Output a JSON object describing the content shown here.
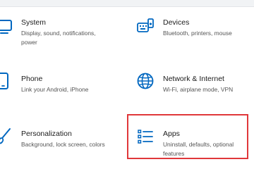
{
  "settings": {
    "tiles": [
      {
        "title": "System",
        "desc": "Display, sound, notifications, power",
        "icon": "monitor-icon"
      },
      {
        "title": "Devices",
        "desc": "Bluetooth, printers, mouse",
        "icon": "keyboard-speaker-icon"
      },
      {
        "title": "Phone",
        "desc": "Link your Android, iPhone",
        "icon": "phone-icon"
      },
      {
        "title": "Network & Internet",
        "desc": "Wi-Fi, airplane mode, VPN",
        "icon": "globe-icon"
      },
      {
        "title": "Personalization",
        "desc": "Background, lock screen, colors",
        "icon": "paintbrush-icon"
      },
      {
        "title": "Apps",
        "desc": "Uninstall, defaults, optional features",
        "icon": "apps-list-icon"
      }
    ],
    "highlighted_tile": "Apps"
  },
  "colors": {
    "accent": "#0067c0",
    "highlight": "#e0373a"
  }
}
